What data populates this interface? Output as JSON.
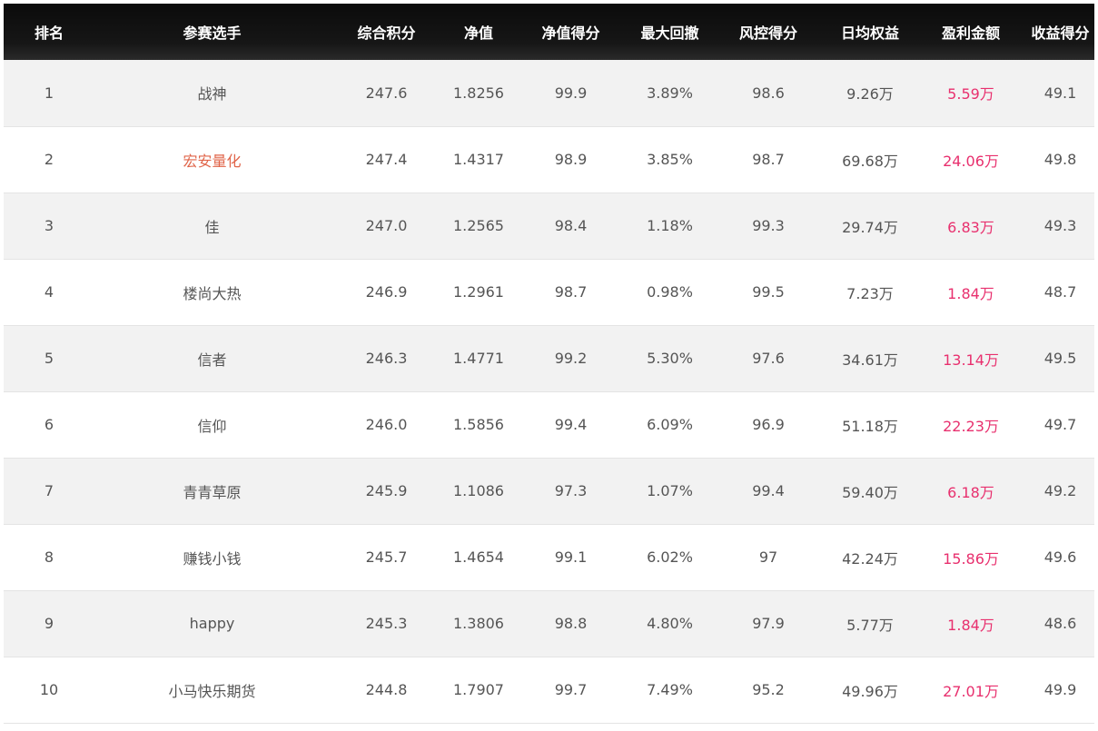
{
  "table": {
    "headers": {
      "rank": "排名",
      "player": "参赛选手",
      "total_score": "综合积分",
      "nav": "净值",
      "nav_score": "净值得分",
      "max_drawdown": "最大回撤",
      "risk_score": "风控得分",
      "daily_equity": "日均权益",
      "profit": "盈利金额",
      "return_score": "收益得分"
    },
    "rows": [
      {
        "rank": "1",
        "player": "战神",
        "total_score": "247.6",
        "nav": "1.8256",
        "nav_score": "99.9",
        "max_drawdown": "3.89%",
        "risk_score": "98.6",
        "daily_equity": "9.26万",
        "profit": "5.59万",
        "return_score": "49.1"
      },
      {
        "rank": "2",
        "player": "宏安量化",
        "total_score": "247.4",
        "nav": "1.4317",
        "nav_score": "98.9",
        "max_drawdown": "3.85%",
        "risk_score": "98.7",
        "daily_equity": "69.68万",
        "profit": "24.06万",
        "return_score": "49.8"
      },
      {
        "rank": "3",
        "player": "佳",
        "total_score": "247.0",
        "nav": "1.2565",
        "nav_score": "98.4",
        "max_drawdown": "1.18%",
        "risk_score": "99.3",
        "daily_equity": "29.74万",
        "profit": "6.83万",
        "return_score": "49.3"
      },
      {
        "rank": "4",
        "player": "楼尚大热",
        "total_score": "246.9",
        "nav": "1.2961",
        "nav_score": "98.7",
        "max_drawdown": "0.98%",
        "risk_score": "99.5",
        "daily_equity": "7.23万",
        "profit": "1.84万",
        "return_score": "48.7"
      },
      {
        "rank": "5",
        "player": "信者",
        "total_score": "246.3",
        "nav": "1.4771",
        "nav_score": "99.2",
        "max_drawdown": "5.30%",
        "risk_score": "97.6",
        "daily_equity": "34.61万",
        "profit": "13.14万",
        "return_score": "49.5"
      },
      {
        "rank": "6",
        "player": "信仰",
        "total_score": "246.0",
        "nav": "1.5856",
        "nav_score": "99.4",
        "max_drawdown": "6.09%",
        "risk_score": "96.9",
        "daily_equity": "51.18万",
        "profit": "22.23万",
        "return_score": "49.7"
      },
      {
        "rank": "7",
        "player": "青青草原",
        "total_score": "245.9",
        "nav": "1.1086",
        "nav_score": "97.3",
        "max_drawdown": "1.07%",
        "risk_score": "99.4",
        "daily_equity": "59.40万",
        "profit": "6.18万",
        "return_score": "49.2"
      },
      {
        "rank": "8",
        "player": "赚钱小钱",
        "total_score": "245.7",
        "nav": "1.4654",
        "nav_score": "99.1",
        "max_drawdown": "6.02%",
        "risk_score": "97",
        "daily_equity": "42.24万",
        "profit": "15.86万",
        "return_score": "49.6"
      },
      {
        "rank": "9",
        "player": "happy",
        "total_score": "245.3",
        "nav": "1.3806",
        "nav_score": "98.8",
        "max_drawdown": "4.80%",
        "risk_score": "97.9",
        "daily_equity": "5.77万",
        "profit": "1.84万",
        "return_score": "48.6"
      },
      {
        "rank": "10",
        "player": "小马快乐期货",
        "total_score": "244.8",
        "nav": "1.7907",
        "nav_score": "99.7",
        "max_drawdown": "7.49%",
        "risk_score": "95.2",
        "daily_equity": "49.96万",
        "profit": "27.01万",
        "return_score": "49.9"
      }
    ]
  },
  "colors": {
    "header_bg": "#111111",
    "header_text": "#ffffff",
    "text": "#555555",
    "highlight_name": "#e0654a",
    "profit": "#e8306e",
    "row_alt": "#f2f2f2"
  }
}
